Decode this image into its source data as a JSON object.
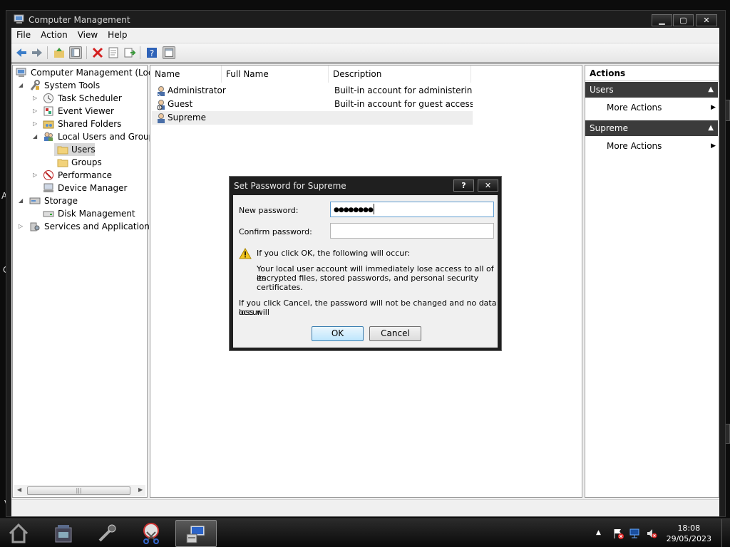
{
  "window": {
    "title": "Computer Management"
  },
  "menu": [
    "File",
    "Action",
    "View",
    "Help"
  ],
  "tree": {
    "root": "Computer Management (Local",
    "system_tools": "System Tools",
    "task_scheduler": "Task Scheduler",
    "event_viewer": "Event Viewer",
    "shared_folders": "Shared Folders",
    "local_users_groups": "Local Users and Groups",
    "users": "Users",
    "groups": "Groups",
    "performance": "Performance",
    "device_manager": "Device Manager",
    "storage": "Storage",
    "disk_management": "Disk Management",
    "services_apps": "Services and Applications"
  },
  "list": {
    "columns": [
      "Name",
      "Full Name",
      "Description"
    ],
    "rows": [
      {
        "name": "Administrator",
        "full_name": "",
        "description": "Built-in account for administering..."
      },
      {
        "name": "Guest",
        "full_name": "",
        "description": "Built-in account for guest access t..."
      },
      {
        "name": "Supreme",
        "full_name": "",
        "description": ""
      }
    ]
  },
  "actions": {
    "header": "Actions",
    "sections": [
      {
        "title": "Users",
        "item": "More Actions"
      },
      {
        "title": "Supreme",
        "item": "More Actions"
      }
    ]
  },
  "dialog": {
    "title": "Set Password for Supreme",
    "help_label": "?",
    "close_label": "✕",
    "new_password_label": "New password:",
    "new_password_value": "●●●●●●●●",
    "confirm_password_label": "Confirm password:",
    "confirm_password_value": "",
    "warning_heading": "If you click OK, the following will occur:",
    "warning_line1": "Your local user account will immediately lose access to all of its",
    "warning_line2": "encrypted files, stored passwords, and personal security certificates.",
    "cancel_note_line1": "If you click Cancel, the password will not be changed and no data loss will",
    "cancel_note_line2": "occur.",
    "ok_label": "OK",
    "cancel_label": "Cancel"
  },
  "taskbar": {
    "clock_time": "18:08",
    "clock_date": "29/05/2023"
  },
  "colors": {
    "window_frame": "#1d1d1d",
    "action_header": "#3b3b3b",
    "selection": "#d9d9d9",
    "ok_button": "#bee6fd"
  }
}
